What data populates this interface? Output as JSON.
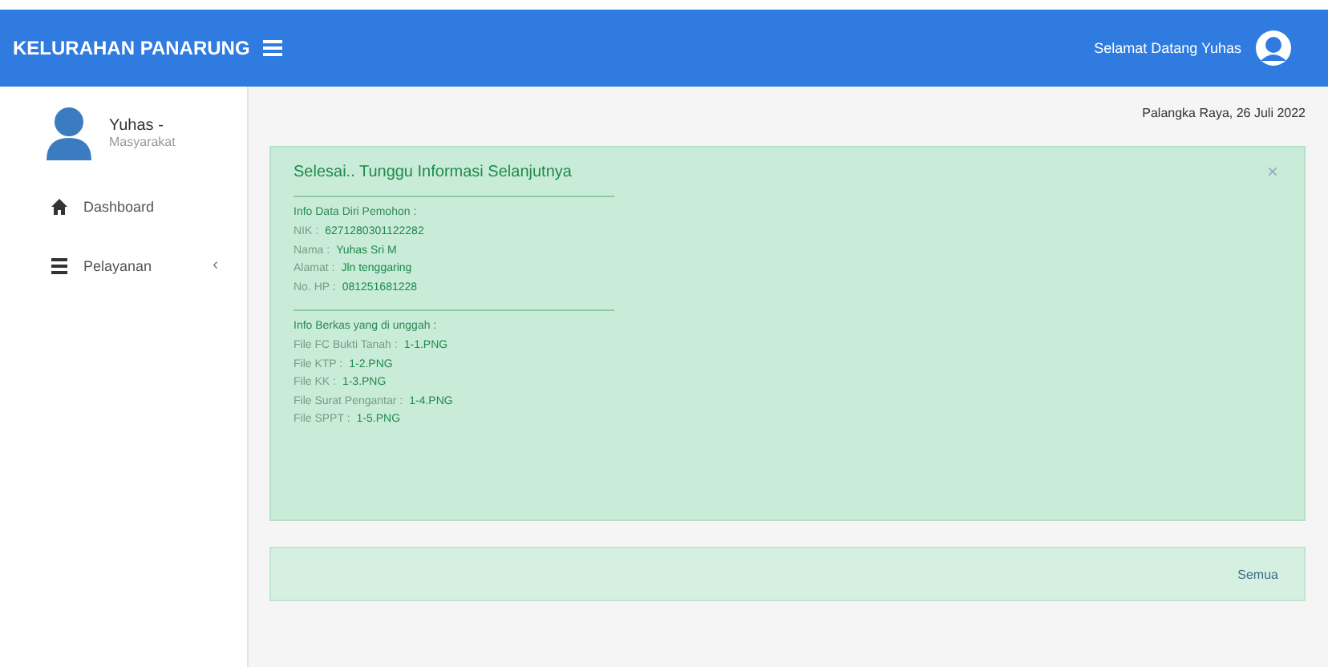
{
  "topbar": {
    "brand": "KELURAHAN PANARUNG",
    "greeting": "Selamat Datang Yuhas"
  },
  "sidebar": {
    "user": {
      "name": "Yuhas -",
      "role": "Masyarakat"
    },
    "items": [
      {
        "label": "Dashboard"
      },
      {
        "label": "Pelayanan",
        "caret": "‹"
      }
    ]
  },
  "date": "Palangka Raya, 26 Juli 2022",
  "alert": {
    "title": "Selesai.. Tunggu Informasi Selanjutnya",
    "close": "×",
    "sections": [
      {
        "heading": "Info Data Diri Pemohon :",
        "fields": [
          {
            "label": "NIK :",
            "value": "6271280301122282"
          },
          {
            "label": "Nama :",
            "value": "Yuhas Sri M"
          },
          {
            "label": "Alamat :",
            "value": "Jln tenggaring"
          },
          {
            "label": "No. HP :",
            "value": "081251681228"
          }
        ]
      },
      {
        "heading": "Info Berkas yang di unggah :",
        "fields": [
          {
            "label": "File FC Bukti Tanah :",
            "value": "1-1.PNG"
          },
          {
            "label": "File KTP :",
            "value": "1-2.PNG"
          },
          {
            "label": "File KK :",
            "value": "1-3.PNG"
          },
          {
            "label": "File Surat Pengantar :",
            "value": "1-4.PNG"
          },
          {
            "label": "File SPPT :",
            "value": "1-5.PNG"
          }
        ]
      }
    ]
  },
  "footer_card": {
    "link": "Semua"
  }
}
